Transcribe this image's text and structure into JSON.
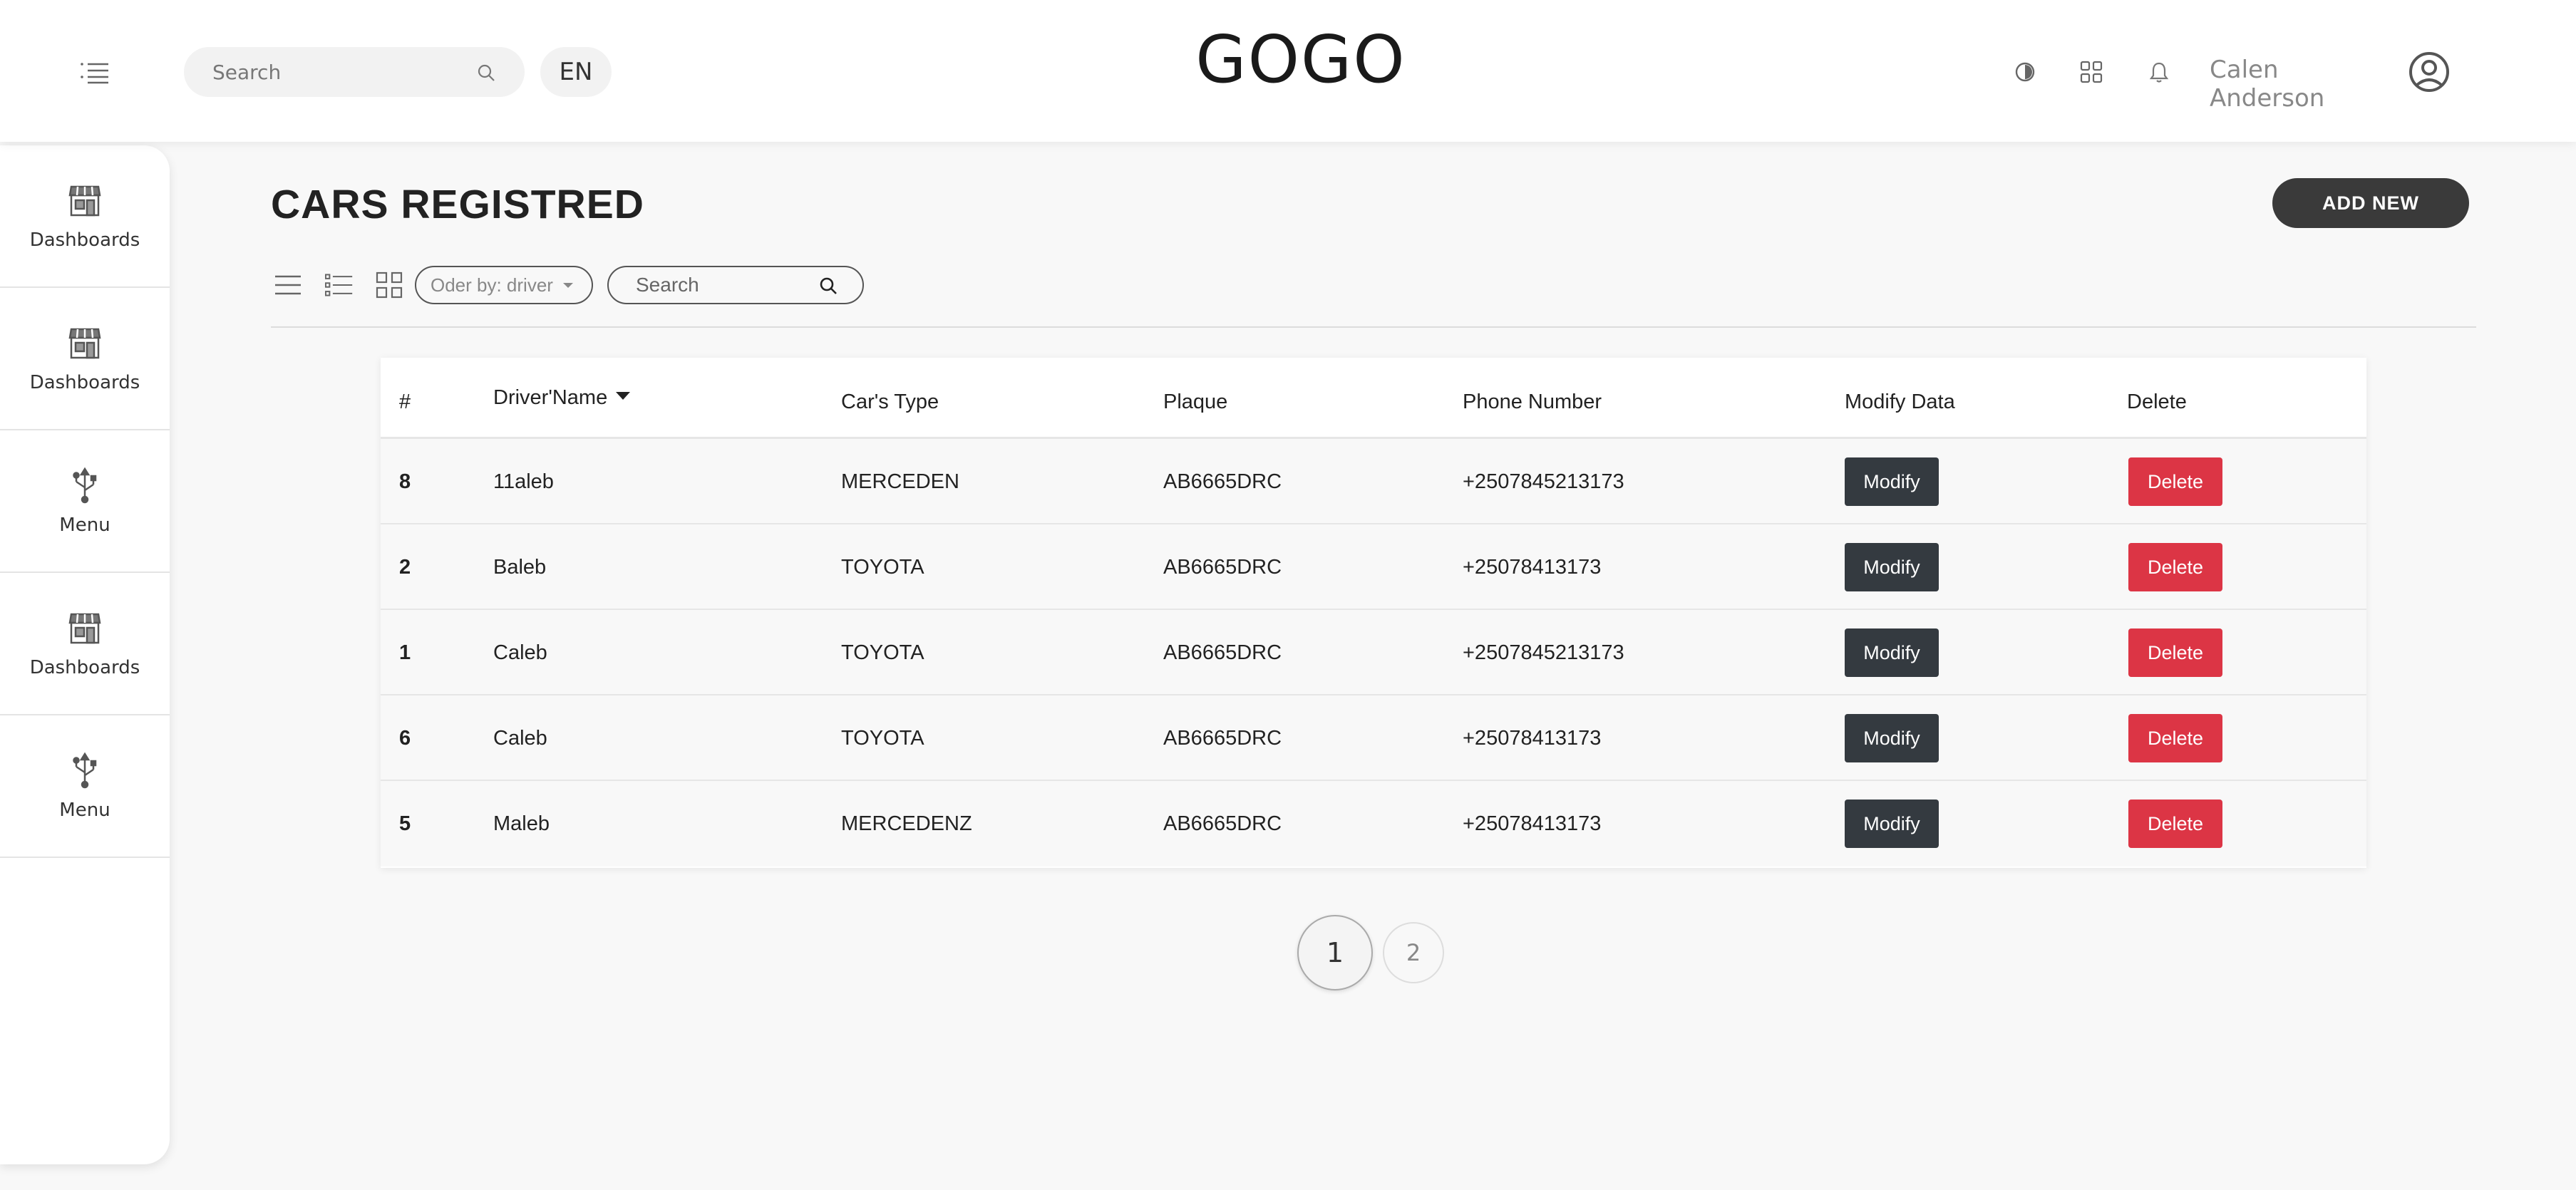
{
  "header": {
    "search_placeholder": "Search",
    "language": "EN",
    "logo": "GOGO",
    "user_name": "Calen Anderson"
  },
  "sidebar": {
    "items": [
      {
        "label": "Dashboards",
        "icon": "shop-icon"
      },
      {
        "label": "Dashboards",
        "icon": "shop-icon"
      },
      {
        "label": "Menu",
        "icon": "usb-icon"
      },
      {
        "label": "Dashboards",
        "icon": "shop-icon"
      },
      {
        "label": "Menu",
        "icon": "usb-icon"
      }
    ]
  },
  "main": {
    "title": "CARS REGISTRED",
    "add_button": "ADD NEW",
    "order_by": "Oder by: driver",
    "search_placeholder": "Search"
  },
  "table": {
    "headers": {
      "num": "#",
      "driver": "Driver'Name",
      "car_type": "Car's Type",
      "plaque": "Plaque",
      "phone": "Phone Number",
      "modify": "Modify Data",
      "delete": "Delete"
    },
    "modify_label": "Modify",
    "delete_label": "Delete",
    "rows": [
      {
        "num": "8",
        "driver": "11aleb",
        "car_type": "MERCEDEN",
        "plaque": "AB6665DRC",
        "phone": "+2507845213173"
      },
      {
        "num": "2",
        "driver": "Baleb",
        "car_type": "TOYOTA",
        "plaque": "AB6665DRC",
        "phone": "+25078413173"
      },
      {
        "num": "1",
        "driver": "Caleb",
        "car_type": "TOYOTA",
        "plaque": "AB6665DRC",
        "phone": "+2507845213173"
      },
      {
        "num": "6",
        "driver": "Caleb",
        "car_type": "TOYOTA",
        "plaque": "AB6665DRC",
        "phone": "+25078413173"
      },
      {
        "num": "5",
        "driver": "Maleb",
        "car_type": "MERCEDENZ",
        "plaque": "AB6665DRC",
        "phone": "+25078413173"
      }
    ]
  },
  "pagination": {
    "pages": [
      "1",
      "2"
    ],
    "current": "1"
  },
  "colors": {
    "modify_button": "#343a40",
    "delete_button": "#dc3545",
    "add_button": "#3a3a3a"
  }
}
